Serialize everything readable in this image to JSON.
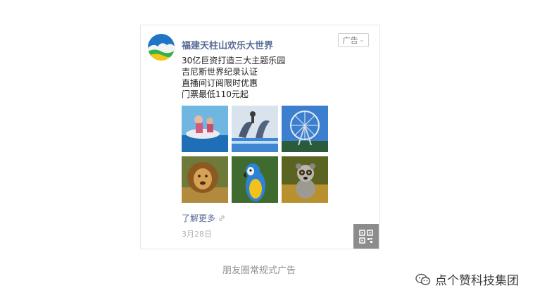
{
  "ad_card": {
    "account_name": "福建天柱山欢乐大世界",
    "ad_badge_label": "广告",
    "ad_badge_icon": "chevron-down-icon",
    "text_lines": [
      "30亿巨资打造三大主题乐园",
      "吉尼斯世界纪录认证",
      "直播间订阅限时优惠",
      "门票最低110元起"
    ],
    "learn_more_label": "了解更多",
    "learn_more_icon": "link-icon",
    "date": "3月28日",
    "qr_icon": "qr-code-icon"
  },
  "caption": "朋友圈常规式广告",
  "watermark": {
    "icon": "wechat-icon",
    "text": "点个赞科技集团"
  }
}
